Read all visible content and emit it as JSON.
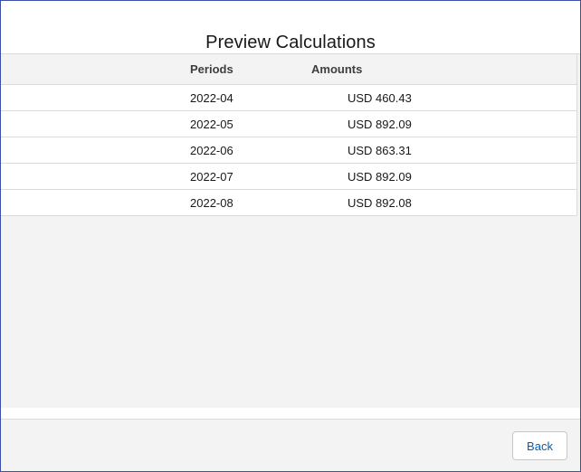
{
  "modal": {
    "title": "Preview Calculations"
  },
  "table": {
    "columns": {
      "periods": "Periods",
      "amounts": "Amounts"
    },
    "rows": [
      {
        "period": "2022-04",
        "amount": "USD 460.43"
      },
      {
        "period": "2022-05",
        "amount": "USD 892.09"
      },
      {
        "period": "2022-06",
        "amount": "USD 863.31"
      },
      {
        "period": "2022-07",
        "amount": "USD 892.09"
      },
      {
        "period": "2022-08",
        "amount": "USD 892.08"
      }
    ]
  },
  "footer": {
    "back_label": "Back"
  },
  "colors": {
    "modal_border": "#3f4fa8",
    "link_blue": "#0b5cab",
    "body_gray": "#f3f3f3"
  }
}
